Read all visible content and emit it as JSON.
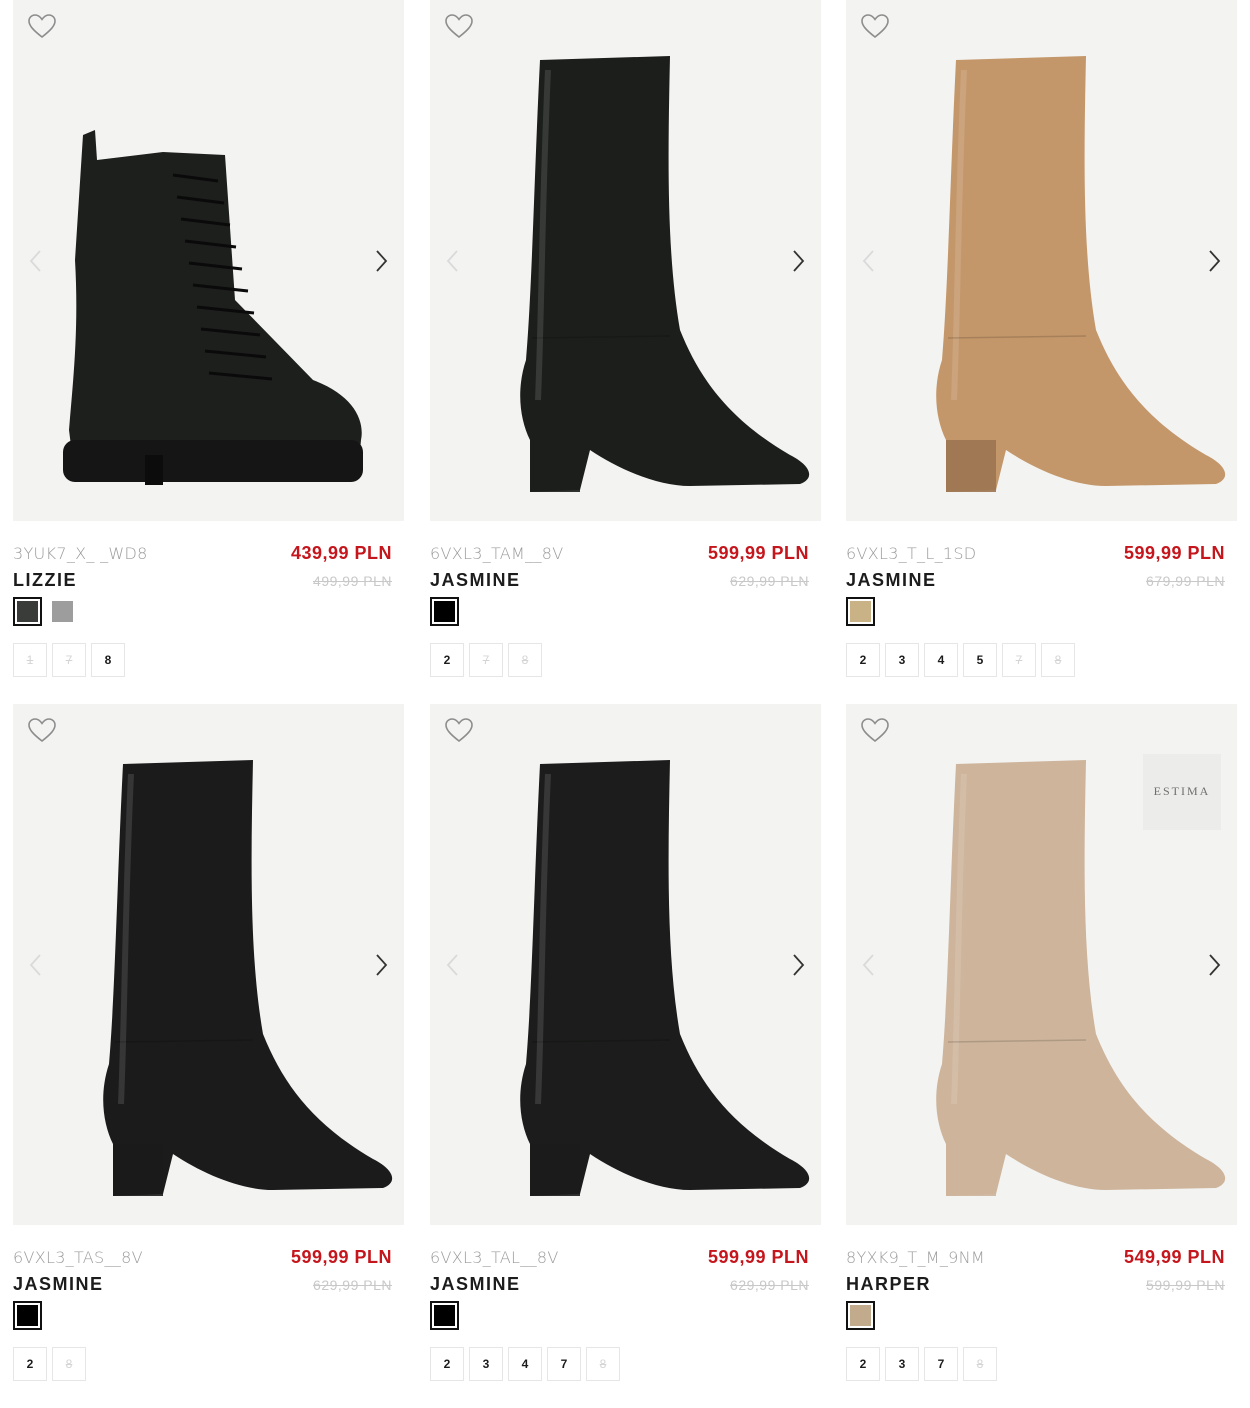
{
  "colors": {
    "price_red": "#c4161c",
    "bg_image": "#f3f3f2"
  },
  "icons": {
    "wishlist": "heart-outline-icon",
    "prev": "chevron-left-icon",
    "next": "chevron-right-icon"
  },
  "products": [
    {
      "sku": "3YUK7_X_ _WD8",
      "name": "LIZZIE",
      "price": "439,99 PLN",
      "old_price": "499,99 PLN",
      "boot_style": "ankle-lace",
      "boot_color": "#1d1f1d",
      "brand_badge": "",
      "swatches": [
        {
          "color": "#3a3c3a",
          "selected": true
        },
        {
          "color": "#9d9d9d",
          "selected": false
        }
      ],
      "sizes": [
        {
          "label": "1",
          "available": false
        },
        {
          "label": "7",
          "available": false
        },
        {
          "label": "8",
          "available": true
        }
      ]
    },
    {
      "sku": "6VXL3_TAM__8V",
      "name": "JASMINE",
      "price": "599,99 PLN",
      "old_price": "629,99 PLN",
      "boot_style": "knee-block",
      "boot_color": "#1c1e1c",
      "brand_badge": "",
      "swatches": [
        {
          "color": "#000000",
          "selected": true
        }
      ],
      "sizes": [
        {
          "label": "2",
          "available": true
        },
        {
          "label": "7",
          "available": false
        },
        {
          "label": "8",
          "available": false
        }
      ]
    },
    {
      "sku": "6VXL3_T_L_1SD",
      "name": "JASMINE",
      "price": "599,99 PLN",
      "old_price": "679,99 PLN",
      "boot_style": "knee-block",
      "boot_color": "#c4976a",
      "brand_badge": "",
      "swatches": [
        {
          "color": "#c9b386",
          "selected": true
        }
      ],
      "sizes": [
        {
          "label": "2",
          "available": true
        },
        {
          "label": "3",
          "available": true
        },
        {
          "label": "4",
          "available": true
        },
        {
          "label": "5",
          "available": true
        },
        {
          "label": "7",
          "available": false
        },
        {
          "label": "8",
          "available": false
        }
      ]
    },
    {
      "sku": "6VXL3_TAS__8V",
      "name": "JASMINE",
      "price": "599,99 PLN",
      "old_price": "629,99 PLN",
      "boot_style": "knee-block",
      "boot_color": "#1b1b1b",
      "brand_badge": "",
      "swatches": [
        {
          "color": "#000000",
          "selected": true
        }
      ],
      "sizes": [
        {
          "label": "2",
          "available": true
        },
        {
          "label": "8",
          "available": false
        }
      ]
    },
    {
      "sku": "6VXL3_TAL__8V",
      "name": "JASMINE",
      "price": "599,99 PLN",
      "old_price": "629,99 PLN",
      "boot_style": "knee-block",
      "boot_color": "#1b1c1b",
      "brand_badge": "",
      "swatches": [
        {
          "color": "#000000",
          "selected": true
        }
      ],
      "sizes": [
        {
          "label": "2",
          "available": true
        },
        {
          "label": "3",
          "available": true
        },
        {
          "label": "4",
          "available": true
        },
        {
          "label": "7",
          "available": true
        },
        {
          "label": "8",
          "available": false
        }
      ]
    },
    {
      "sku": "8YXK9_T_M_9NM",
      "name": "HARPER",
      "price": "549,99 PLN",
      "old_price": "599,99 PLN",
      "boot_style": "knee-block",
      "boot_color": "#cdb49b",
      "brand_badge": "ESTIMA",
      "swatches": [
        {
          "color": "#c2ab8c",
          "selected": true
        }
      ],
      "sizes": [
        {
          "label": "2",
          "available": true
        },
        {
          "label": "3",
          "available": true
        },
        {
          "label": "7",
          "available": true
        },
        {
          "label": "8",
          "available": false
        }
      ]
    }
  ]
}
